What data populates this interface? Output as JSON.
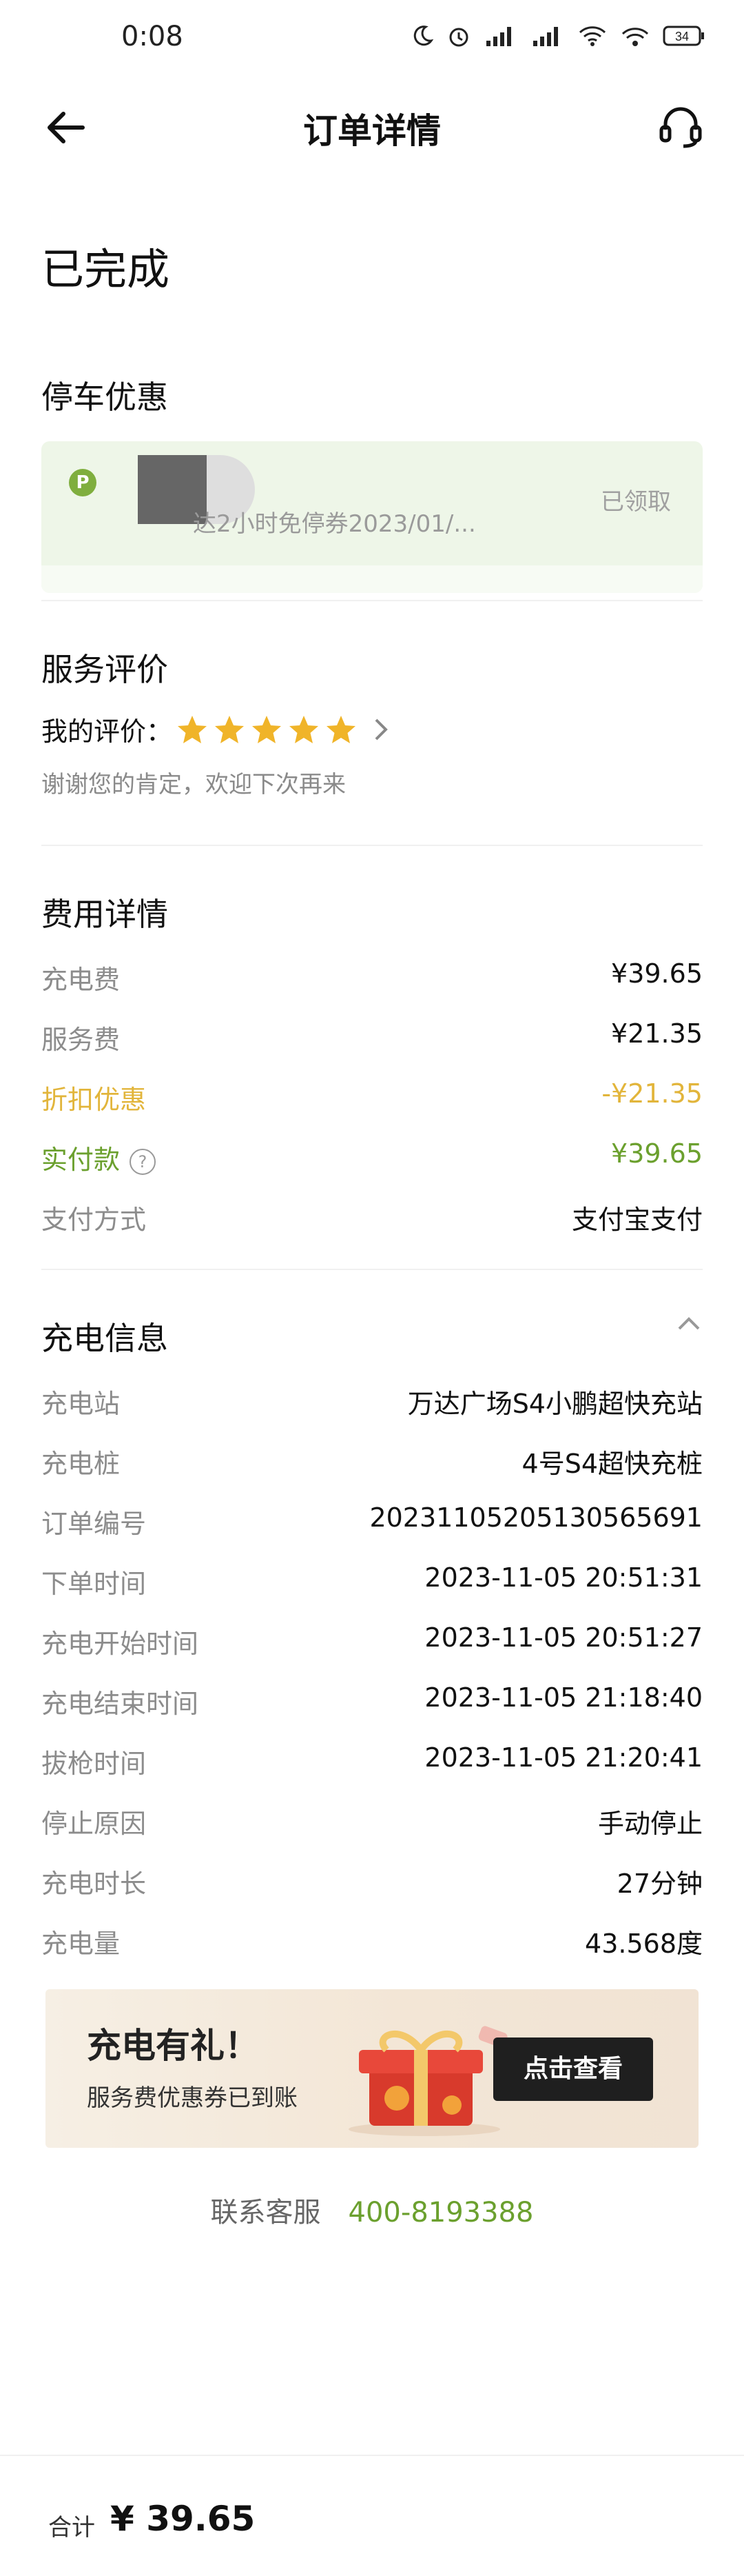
{
  "status_bar": {
    "time": "0:08",
    "battery": "34"
  },
  "header": {
    "title": "订单详情"
  },
  "order_status": "已完成",
  "parking": {
    "section_title": "停车优惠",
    "coupon_text": "达2小时免停券2023/01/...",
    "coupon_status": "已领取",
    "badge": "P"
  },
  "review": {
    "section_title": "服务评价",
    "label": "我的评价：",
    "stars": 5,
    "note": "谢谢您的肯定，欢迎下次再来"
  },
  "fees": {
    "section_title": "费用详情",
    "rows": [
      {
        "label": "充电费",
        "value": "¥39.65"
      },
      {
        "label": "服务费",
        "value": "¥21.35"
      },
      {
        "label": "折扣优惠",
        "value": "-¥21.35"
      },
      {
        "label": "实付款",
        "value": "¥39.65"
      },
      {
        "label": "支付方式",
        "value": "支付宝支付"
      }
    ]
  },
  "charging": {
    "section_title": "充电信息",
    "rows": [
      {
        "label": "充电站",
        "value": "万达广场S4小鹏超快充站"
      },
      {
        "label": "充电桩",
        "value": "4号S4超快充桩"
      },
      {
        "label": "订单编号",
        "value": "20231105205130565691"
      },
      {
        "label": "下单时间",
        "value": "2023-11-05 20:51:31"
      },
      {
        "label": "充电开始时间",
        "value": "2023-11-05 20:51:27"
      },
      {
        "label": "充电结束时间",
        "value": "2023-11-05 21:18:40"
      },
      {
        "label": "拔枪时间",
        "value": "2023-11-05 21:20:41"
      },
      {
        "label": "停止原因",
        "value": "手动停止"
      },
      {
        "label": "充电时长",
        "value": "27分钟"
      },
      {
        "label": "充电量",
        "value": "43.568度"
      }
    ]
  },
  "banner": {
    "title": "充电有礼！",
    "subtitle": "服务费优惠券已到账",
    "cta": "点击查看"
  },
  "contact": {
    "label": "联系客服",
    "phone": "400-8193388"
  },
  "footer": {
    "total_label": "合计",
    "total_value": "¥ 39.65"
  },
  "colors": {
    "accent_green": "#6ba02e",
    "discount_gold": "#e2b53b",
    "star_gold": "#f0b429"
  }
}
